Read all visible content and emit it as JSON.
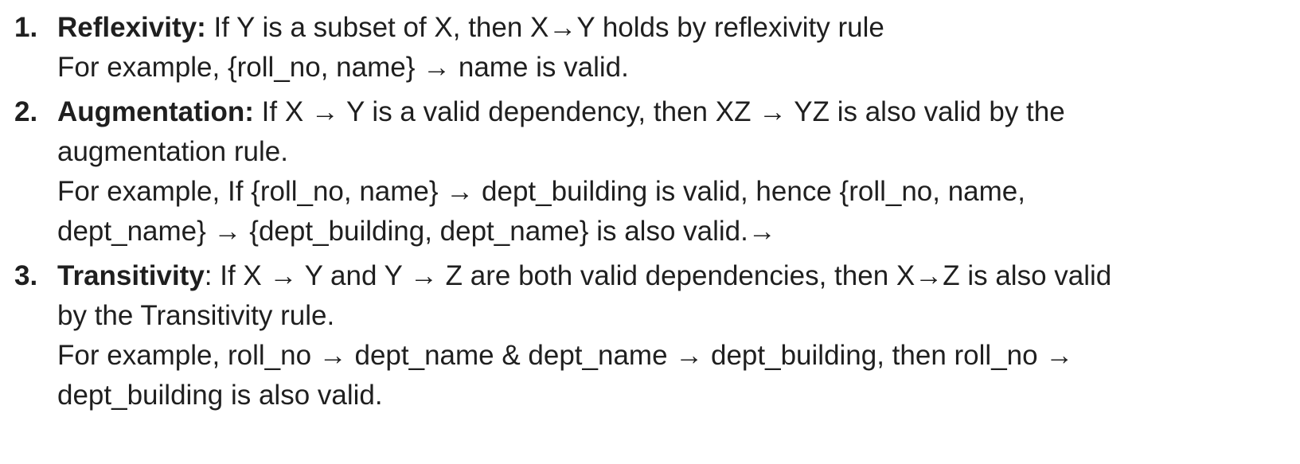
{
  "rules": [
    {
      "number": "1.",
      "term": "Reflexivity:",
      "lines": [
        " If Y is a subset of X, then X→Y holds by reflexivity rule",
        "For example, {roll_no, name} → name is valid."
      ]
    },
    {
      "number": "2.",
      "term": "Augmentation:",
      "lines": [
        " If X → Y is a valid dependency, then XZ → YZ is also valid by the",
        "augmentation rule.",
        "For example, If {roll_no, name} → dept_building is valid, hence {roll_no, name,",
        "dept_name} → {dept_building, dept_name} is also valid.→"
      ]
    },
    {
      "number": "3.",
      "term": "Transitivity",
      "lines": [
        ": If X → Y and Y → Z are both valid dependencies, then X→Z is also valid",
        "by the Transitivity rule.",
        "For example, roll_no → dept_name & dept_name → dept_building, then roll_no →",
        "dept_building is also valid."
      ]
    }
  ]
}
